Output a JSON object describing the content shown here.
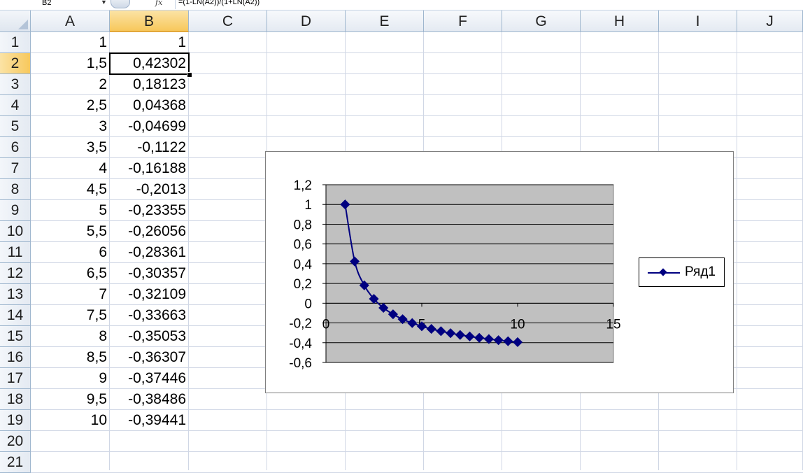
{
  "formula_bar": {
    "name_box": "B2",
    "fx_label": "fx",
    "formula": "=(1-LN(A2))/(1+LN(A2))"
  },
  "columns": [
    "A",
    "B",
    "C",
    "D",
    "E",
    "F",
    "G",
    "H",
    "I",
    "J"
  ],
  "selected_column": "B",
  "selected_row": 2,
  "rows": [
    {
      "num": "1",
      "a": "1",
      "b": "1"
    },
    {
      "num": "2",
      "a": "1,5",
      "b": "0,42302"
    },
    {
      "num": "3",
      "a": "2",
      "b": "0,18123"
    },
    {
      "num": "4",
      "a": "2,5",
      "b": "0,04368"
    },
    {
      "num": "5",
      "a": "3",
      "b": "-0,04699"
    },
    {
      "num": "6",
      "a": "3,5",
      "b": "-0,1122"
    },
    {
      "num": "7",
      "a": "4",
      "b": "-0,16188"
    },
    {
      "num": "8",
      "a": "4,5",
      "b": "-0,2013"
    },
    {
      "num": "9",
      "a": "5",
      "b": "-0,23355"
    },
    {
      "num": "10",
      "a": "5,5",
      "b": "-0,26056"
    },
    {
      "num": "11",
      "a": "6",
      "b": "-0,28361"
    },
    {
      "num": "12",
      "a": "6,5",
      "b": "-0,30357"
    },
    {
      "num": "13",
      "a": "7",
      "b": "-0,32109"
    },
    {
      "num": "14",
      "a": "7,5",
      "b": "-0,33663"
    },
    {
      "num": "15",
      "a": "8",
      "b": "-0,35053"
    },
    {
      "num": "16",
      "a": "8,5",
      "b": "-0,36307"
    },
    {
      "num": "17",
      "a": "9",
      "b": "-0,37446"
    },
    {
      "num": "18",
      "a": "9,5",
      "b": "-0,38486"
    },
    {
      "num": "19",
      "a": "10",
      "b": "-0,39441"
    },
    {
      "num": "20",
      "a": "",
      "b": ""
    },
    {
      "num": "21",
      "a": "",
      "b": ""
    }
  ],
  "chart_data": {
    "type": "scatter",
    "x": [
      1,
      1.5,
      2,
      2.5,
      3,
      3.5,
      4,
      4.5,
      5,
      5.5,
      6,
      6.5,
      7,
      7.5,
      8,
      8.5,
      9,
      9.5,
      10
    ],
    "series": [
      {
        "name": "Ряд1",
        "color": "#000080",
        "values": [
          1,
          0.42302,
          0.18123,
          0.04368,
          -0.04699,
          -0.1122,
          -0.16188,
          -0.2013,
          -0.23355,
          -0.26056,
          -0.28361,
          -0.30357,
          -0.32109,
          -0.33663,
          -0.35053,
          -0.36307,
          -0.37446,
          -0.38486,
          -0.39441
        ]
      }
    ],
    "xlim": [
      0,
      15
    ],
    "ylim": [
      -0.6,
      1.2
    ],
    "x_ticks": [
      {
        "v": 0,
        "label": "0"
      },
      {
        "v": 5,
        "label": "5"
      },
      {
        "v": 10,
        "label": "10"
      },
      {
        "v": 15,
        "label": "15"
      }
    ],
    "y_ticks": [
      {
        "v": 1.2,
        "label": "1,2"
      },
      {
        "v": 1,
        "label": "1"
      },
      {
        "v": 0.8,
        "label": "0,8"
      },
      {
        "v": 0.6,
        "label": "0,6"
      },
      {
        "v": 0.4,
        "label": "0,4"
      },
      {
        "v": 0.2,
        "label": "0,2"
      },
      {
        "v": 0,
        "label": "0"
      },
      {
        "v": -0.2,
        "label": "-0,2"
      },
      {
        "v": -0.4,
        "label": "-0,4"
      },
      {
        "v": -0.6,
        "label": "-0,6"
      }
    ],
    "grid": true,
    "plot_background": "#c0c0c0",
    "legend_position": "right",
    "title": "",
    "xlabel": "",
    "ylabel": ""
  }
}
